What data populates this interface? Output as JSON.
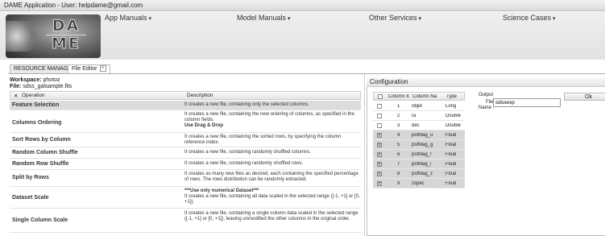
{
  "app": {
    "title": "DAME Application - User: helpdame@gmail.com"
  },
  "logo": {
    "line1": "DA",
    "line2": "ME"
  },
  "menus": [
    {
      "label": "App Manuals"
    },
    {
      "label": "Model Manuals"
    },
    {
      "label": "Other Services"
    },
    {
      "label": "Science Cases"
    }
  ],
  "tabs": [
    {
      "label": "RESOURCE MANAGER"
    },
    {
      "label": "File Editor"
    }
  ],
  "workspace": {
    "label": "Workspace:",
    "value": "photoz",
    "file_label": "File:",
    "file_value": "sdss_galsample.fits"
  },
  "operations": {
    "header_operation": "Operation",
    "header_description": "Description",
    "rows": [
      {
        "name": "Feature Selection",
        "desc": "It creates a new file, containing only the selected columns.",
        "extra": ""
      },
      {
        "name": "Columns Ordering",
        "desc": "It creates a new file, containing the new ordering of columns, as specified in the column fields.",
        "extra": "Use Drag & Drop"
      },
      {
        "name": "Sort Rows by Column",
        "desc": "It creates a new file, containing the sorted rows, by specifying the column reference index.",
        "extra": ""
      },
      {
        "name": "Random Column Shuffle",
        "desc": "It creates a new file, containing randomly shuffled columns.",
        "extra": ""
      },
      {
        "name": "Random Row Shuffle",
        "desc": "It creates a new file, containing randomly shuffled rows.",
        "extra": ""
      },
      {
        "name": "Split by Rows",
        "desc": "It creates as many new files as desired, each containing the specified percentage of rows. The rows distribution can be randomly extracted.",
        "extra": ""
      },
      {
        "name": "Dataset Scale",
        "pre": "***Use only numerical Dataset***",
        "desc": "It creates a new file, containing all data scaled in the selected range ([-1, +1] or [0, +1]).",
        "extra": ""
      },
      {
        "name": "Single Column Scale",
        "desc": "It creates a new file, containing a single column data scaled in the selected range ([-1, +1] or [0, +1]), leaving unmodified the other columns in the original order.",
        "extra": ""
      }
    ]
  },
  "configuration": {
    "title": "Configuration",
    "header_index": "Column Ic",
    "header_name": "Column Na",
    "header_type": "Type",
    "columns": [
      {
        "index": "1",
        "name": "objid",
        "type": "Long",
        "checked": false
      },
      {
        "index": "2",
        "name": "ra",
        "type": "Double",
        "checked": false
      },
      {
        "index": "3",
        "name": "dec",
        "type": "Double",
        "checked": false
      },
      {
        "index": "4",
        "name": "psfMag_u",
        "type": "Float",
        "checked": true
      },
      {
        "index": "5",
        "name": "psfMag_g",
        "type": "Float",
        "checked": true
      },
      {
        "index": "6",
        "name": "psfMag_r",
        "type": "Float",
        "checked": true
      },
      {
        "index": "7",
        "name": "psfMag_i",
        "type": "Float",
        "checked": true
      },
      {
        "index": "8",
        "name": "psfMag_z",
        "type": "Float",
        "checked": true
      },
      {
        "index": "9",
        "name": "zspec",
        "type": "Float",
        "checked": true
      }
    ],
    "output_label": "Output",
    "file_name_label_1": "File",
    "file_name_label_2": "Name :",
    "file_name_value": "sdssexp",
    "ok_label": "Ok"
  }
}
